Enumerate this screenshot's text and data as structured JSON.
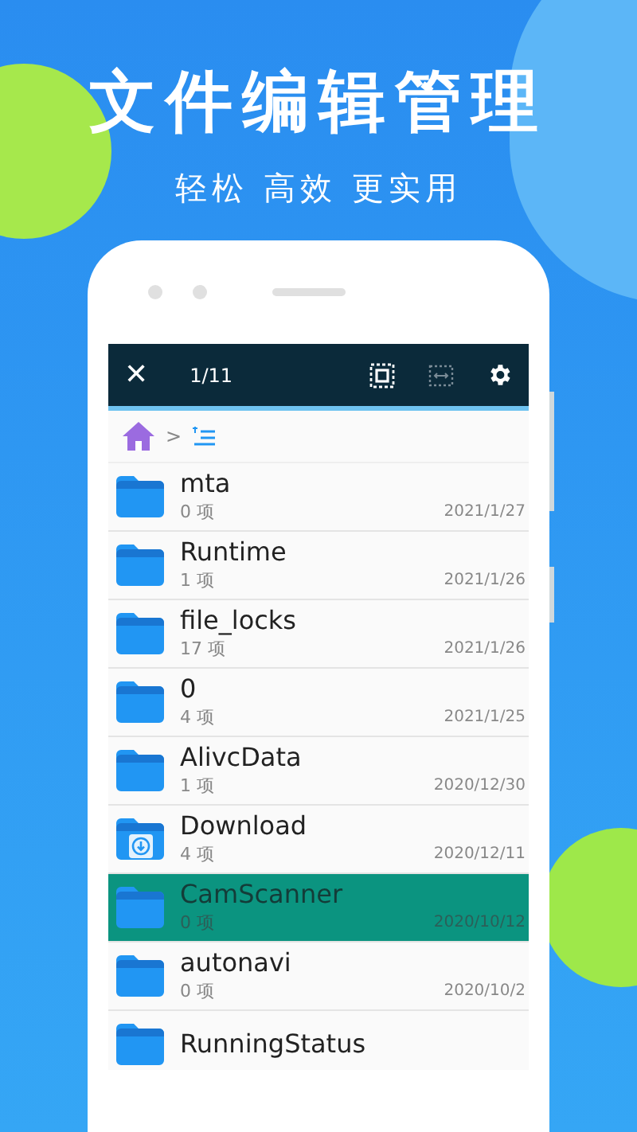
{
  "headline": "文件编辑管理",
  "tagline": "轻松 高效 更实用",
  "toolbar": {
    "close": "✕",
    "counter": "1/11"
  },
  "breadcrumb": {
    "separator": ">"
  },
  "files": [
    {
      "kind": "folder",
      "name": "mta",
      "count": "0 项",
      "date": "2021/1/27",
      "selected": false
    },
    {
      "kind": "folder",
      "name": "Runtime",
      "count": "1 项",
      "date": "2021/1/26",
      "selected": false
    },
    {
      "kind": "folder",
      "name": "file_locks",
      "count": "17 项",
      "date": "2021/1/26",
      "selected": false
    },
    {
      "kind": "folder",
      "name": "0",
      "count": "4 项",
      "date": "2021/1/25",
      "selected": false
    },
    {
      "kind": "folder",
      "name": "AlivcData",
      "count": "1 项",
      "date": "2020/12/30",
      "selected": false
    },
    {
      "kind": "download",
      "name": "Download",
      "count": "4 项",
      "date": "2020/12/11",
      "selected": false
    },
    {
      "kind": "folder",
      "name": "CamScanner",
      "count": "0 项",
      "date": "2020/10/12",
      "selected": true
    },
    {
      "kind": "folder",
      "name": "autonavi",
      "count": "0 项",
      "date": "2020/10/2",
      "selected": false
    },
    {
      "kind": "folder",
      "name": "RunningStatus",
      "selected": false
    }
  ]
}
